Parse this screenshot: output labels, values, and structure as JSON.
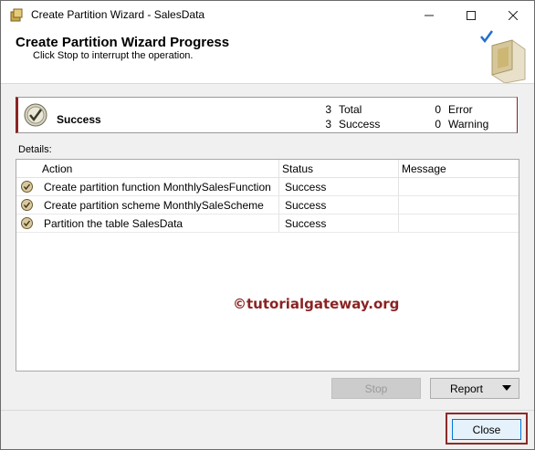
{
  "window": {
    "title": "Create Partition Wizard - SalesData",
    "icons": {
      "app": "wizard-app-icon",
      "minimize": "minimize-icon",
      "maximize": "maximize-icon",
      "close": "close-icon"
    }
  },
  "header": {
    "title": "Create Partition Wizard Progress",
    "subtitle": "Click Stop to interrupt the operation."
  },
  "summary": {
    "status": "Success",
    "total_count": "3",
    "total_label": "Total",
    "success_count": "3",
    "success_label": "Success",
    "error_count": "0",
    "error_label": "Error",
    "warning_count": "0",
    "warning_label": "Warning"
  },
  "details": {
    "label": "Details:",
    "columns": {
      "action": "Action",
      "status": "Status",
      "message": "Message"
    },
    "rows": [
      {
        "action": "Create partition function MonthlySalesFunction",
        "status": "Success",
        "message": ""
      },
      {
        "action": "Create partition scheme MonthlySaleScheme",
        "status": "Success",
        "message": ""
      },
      {
        "action": "Partition the table SalesData",
        "status": "Success",
        "message": ""
      }
    ]
  },
  "watermark": "©tutorialgateway.org",
  "buttons": {
    "stop": "Stop",
    "report": "Report",
    "close": "Close"
  },
  "colors": {
    "accent": "#8b2323",
    "focus": "#0078d7"
  }
}
